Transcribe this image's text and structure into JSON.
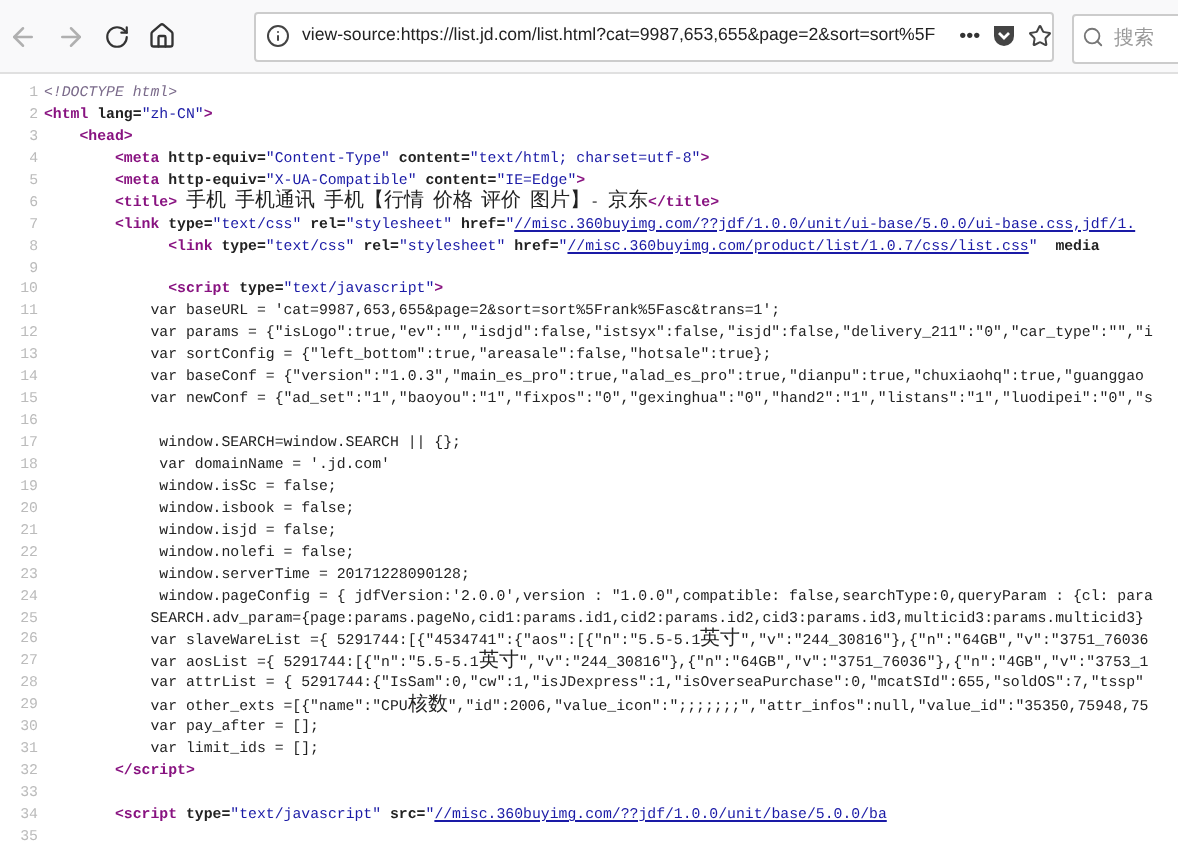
{
  "toolbar": {
    "url": "view-source:https://list.jd.com/list.html?cat=9987,653,655&page=2&sort=sort%5F",
    "page_actions": "•••",
    "search": {
      "placeholder": "搜索"
    }
  },
  "source_lines": [
    {
      "number": "1",
      "tokens": [
        {
          "kind": "comment",
          "text": "<!DOCTYPE html>"
        }
      ]
    },
    {
      "number": "2",
      "tokens": [
        {
          "kind": "tag",
          "text": "<html "
        },
        {
          "kind": "attr",
          "text": "lang="
        },
        {
          "kind": "value",
          "text": "\"zh-CN\""
        },
        {
          "kind": "tag",
          "text": ">"
        }
      ]
    },
    {
      "number": "3",
      "tokens": [
        {
          "kind": "tag",
          "text": "    <head>"
        }
      ]
    },
    {
      "number": "4",
      "tokens": [
        {
          "kind": "tag",
          "text": "        <meta "
        },
        {
          "kind": "attr",
          "text": "http-equiv="
        },
        {
          "kind": "value",
          "text": "\"Content-Type\" "
        },
        {
          "kind": "attr",
          "text": "content="
        },
        {
          "kind": "value",
          "text": "\"text/html; charset=utf-8\""
        },
        {
          "kind": "tag",
          "text": ">"
        }
      ]
    },
    {
      "number": "5",
      "tokens": [
        {
          "kind": "tag",
          "text": "        <meta "
        },
        {
          "kind": "attr",
          "text": "http-equiv="
        },
        {
          "kind": "value",
          "text": "\"X-UA-Compatible\" "
        },
        {
          "kind": "attr",
          "text": "content="
        },
        {
          "kind": "value",
          "text": "\"IE=Edge\""
        },
        {
          "kind": "tag",
          "text": ">"
        }
      ]
    },
    {
      "number": "6",
      "tokens": [
        {
          "kind": "tag",
          "text": "        <title>"
        },
        {
          "kind": "text",
          "text": " 手机 手机通讯 手机【行情 价格 评价 图片】- 京东"
        },
        {
          "kind": "tag",
          "text": "</title>"
        }
      ]
    },
    {
      "number": "7",
      "tokens": [
        {
          "kind": "tag",
          "text": "        <link "
        },
        {
          "kind": "attr",
          "text": "type="
        },
        {
          "kind": "value",
          "text": "\"text/css\" "
        },
        {
          "kind": "attr",
          "text": "rel="
        },
        {
          "kind": "value",
          "text": "\"stylesheet\" "
        },
        {
          "kind": "attr",
          "text": "href="
        },
        {
          "kind": "value",
          "text": "\""
        },
        {
          "kind": "link",
          "text": "//misc.360buyimg.com/??jdf/1.0.0/unit/ui-base/5.0.0/ui-base.css,jdf/1."
        }
      ]
    },
    {
      "number": "8",
      "tokens": [
        {
          "kind": "tag",
          "text": "              <link "
        },
        {
          "kind": "attr",
          "text": "type="
        },
        {
          "kind": "value",
          "text": "\"text/css\" "
        },
        {
          "kind": "attr",
          "text": "rel="
        },
        {
          "kind": "value",
          "text": "\"stylesheet\" "
        },
        {
          "kind": "attr",
          "text": "href="
        },
        {
          "kind": "value",
          "text": "\""
        },
        {
          "kind": "link",
          "text": "//misc.360buyimg.com/product/list/1.0.7/css/list.css"
        },
        {
          "kind": "value",
          "text": "\"  "
        },
        {
          "kind": "attr",
          "text": "media"
        }
      ]
    },
    {
      "number": "9"
    },
    {
      "number": "10",
      "tokens": [
        {
          "kind": "tag",
          "text": "              <script "
        },
        {
          "kind": "attr",
          "text": "type="
        },
        {
          "kind": "value",
          "text": "\"text/javascript\""
        },
        {
          "kind": "tag",
          "text": ">"
        }
      ]
    },
    {
      "number": "11",
      "tokens": [
        {
          "kind": "text",
          "text": "            var baseURL = 'cat=9987,653,655&page=2&sort=sort%5Frank%5Fasc&trans=1';"
        }
      ]
    },
    {
      "number": "12",
      "tokens": [
        {
          "kind": "text",
          "text": "            var params = {\"isLogo\":true,\"ev\":\"\",\"isdjd\":false,\"istsyx\":false,\"isjd\":false,\"delivery_211\":\"0\",\"car_type\":\"\",\"i"
        }
      ]
    },
    {
      "number": "13",
      "tokens": [
        {
          "kind": "text",
          "text": "            var sortConfig = {\"left_bottom\":true,\"areasale\":false,\"hotsale\":true};"
        }
      ]
    },
    {
      "number": "14",
      "tokens": [
        {
          "kind": "text",
          "text": "            var baseConf = {\"version\":\"1.0.3\",\"main_es_pro\":true,\"alad_es_pro\":true,\"dianpu\":true,\"chuxiaohq\":true,\"guanggao"
        }
      ]
    },
    {
      "number": "15",
      "tokens": [
        {
          "kind": "text",
          "text": "            var newConf = {\"ad_set\":\"1\",\"baoyou\":\"1\",\"fixpos\":\"0\",\"gexinghua\":\"0\",\"hand2\":\"1\",\"listans\":\"1\",\"luodipei\":\"0\",\"s"
        }
      ]
    },
    {
      "number": "16"
    },
    {
      "number": "17",
      "tokens": [
        {
          "kind": "text",
          "text": "             window.SEARCH=window.SEARCH || {};"
        }
      ]
    },
    {
      "number": "18",
      "tokens": [
        {
          "kind": "text",
          "text": "             var domainName = '.jd.com'"
        }
      ]
    },
    {
      "number": "19",
      "tokens": [
        {
          "kind": "text",
          "text": "             window.isSc = false;"
        }
      ]
    },
    {
      "number": "20",
      "tokens": [
        {
          "kind": "text",
          "text": "             window.isbook = false;"
        }
      ]
    },
    {
      "number": "21",
      "tokens": [
        {
          "kind": "text",
          "text": "             window.isjd = false;"
        }
      ]
    },
    {
      "number": "22",
      "tokens": [
        {
          "kind": "text",
          "text": "             window.nolefi = false;"
        }
      ]
    },
    {
      "number": "23",
      "tokens": [
        {
          "kind": "text",
          "text": "             window.serverTime = 20171228090128;"
        }
      ]
    },
    {
      "number": "24",
      "tokens": [
        {
          "kind": "text",
          "text": "             window.pageConfig = { jdfVersion:'2.0.0',version : \"1.0.0\",compatible: false,searchType:0,queryParam : {cl: para"
        }
      ]
    },
    {
      "number": "25",
      "tokens": [
        {
          "kind": "text",
          "text": "            SEARCH.adv_param={page:params.pageNo,cid1:params.id1,cid2:params.id2,cid3:params.id3,multicid3:params.multicid3}"
        }
      ]
    },
    {
      "number": "26",
      "tokens": [
        {
          "kind": "text",
          "text": "            var slaveWareList ={ 5291744:[{\"4534741\":{\"aos\":[{\"n\":\"5.5-5.1英寸\",\"v\":\"244_30816\"},{\"n\":\"64GB\",\"v\":\"3751_76036"
        }
      ]
    },
    {
      "number": "27",
      "tokens": [
        {
          "kind": "text",
          "text": "            var aosList ={ 5291744:[{\"n\":\"5.5-5.1英寸\",\"v\":\"244_30816\"},{\"n\":\"64GB\",\"v\":\"3751_76036\"},{\"n\":\"4GB\",\"v\":\"3753_1"
        }
      ]
    },
    {
      "number": "28",
      "tokens": [
        {
          "kind": "text",
          "text": "            var attrList = { 5291744:{\"IsSam\":0,\"cw\":1,\"isJDexpress\":1,\"isOverseaPurchase\":0,\"mcatSId\":655,\"soldOS\":7,\"tssp\""
        }
      ]
    },
    {
      "number": "29",
      "tokens": [
        {
          "kind": "text",
          "text": "            var other_exts =[{\"name\":\"CPU核数\",\"id\":2006,\"value_icon\":\";;;;;;;\",\"attr_infos\":null,\"value_id\":\"35350,75948,75"
        }
      ]
    },
    {
      "number": "30",
      "tokens": [
        {
          "kind": "text",
          "text": "            var pay_after = [];"
        }
      ]
    },
    {
      "number": "31",
      "tokens": [
        {
          "kind": "text",
          "text": "            var limit_ids = [];"
        }
      ]
    },
    {
      "number": "32",
      "tokens": [
        {
          "kind": "tag",
          "text": "        </script>"
        }
      ]
    },
    {
      "number": "33"
    },
    {
      "number": "34",
      "tokens": [
        {
          "kind": "tag",
          "text": "        <script "
        },
        {
          "kind": "attr",
          "text": "type="
        },
        {
          "kind": "value",
          "text": "\"text/javascript\" "
        },
        {
          "kind": "attr",
          "text": "src="
        },
        {
          "kind": "value",
          "text": "\""
        },
        {
          "kind": "link",
          "text": "//misc.360buyimg.com/??jdf/1.0.0/unit/base/5.0.0/ba"
        }
      ]
    },
    {
      "number": "35"
    }
  ]
}
